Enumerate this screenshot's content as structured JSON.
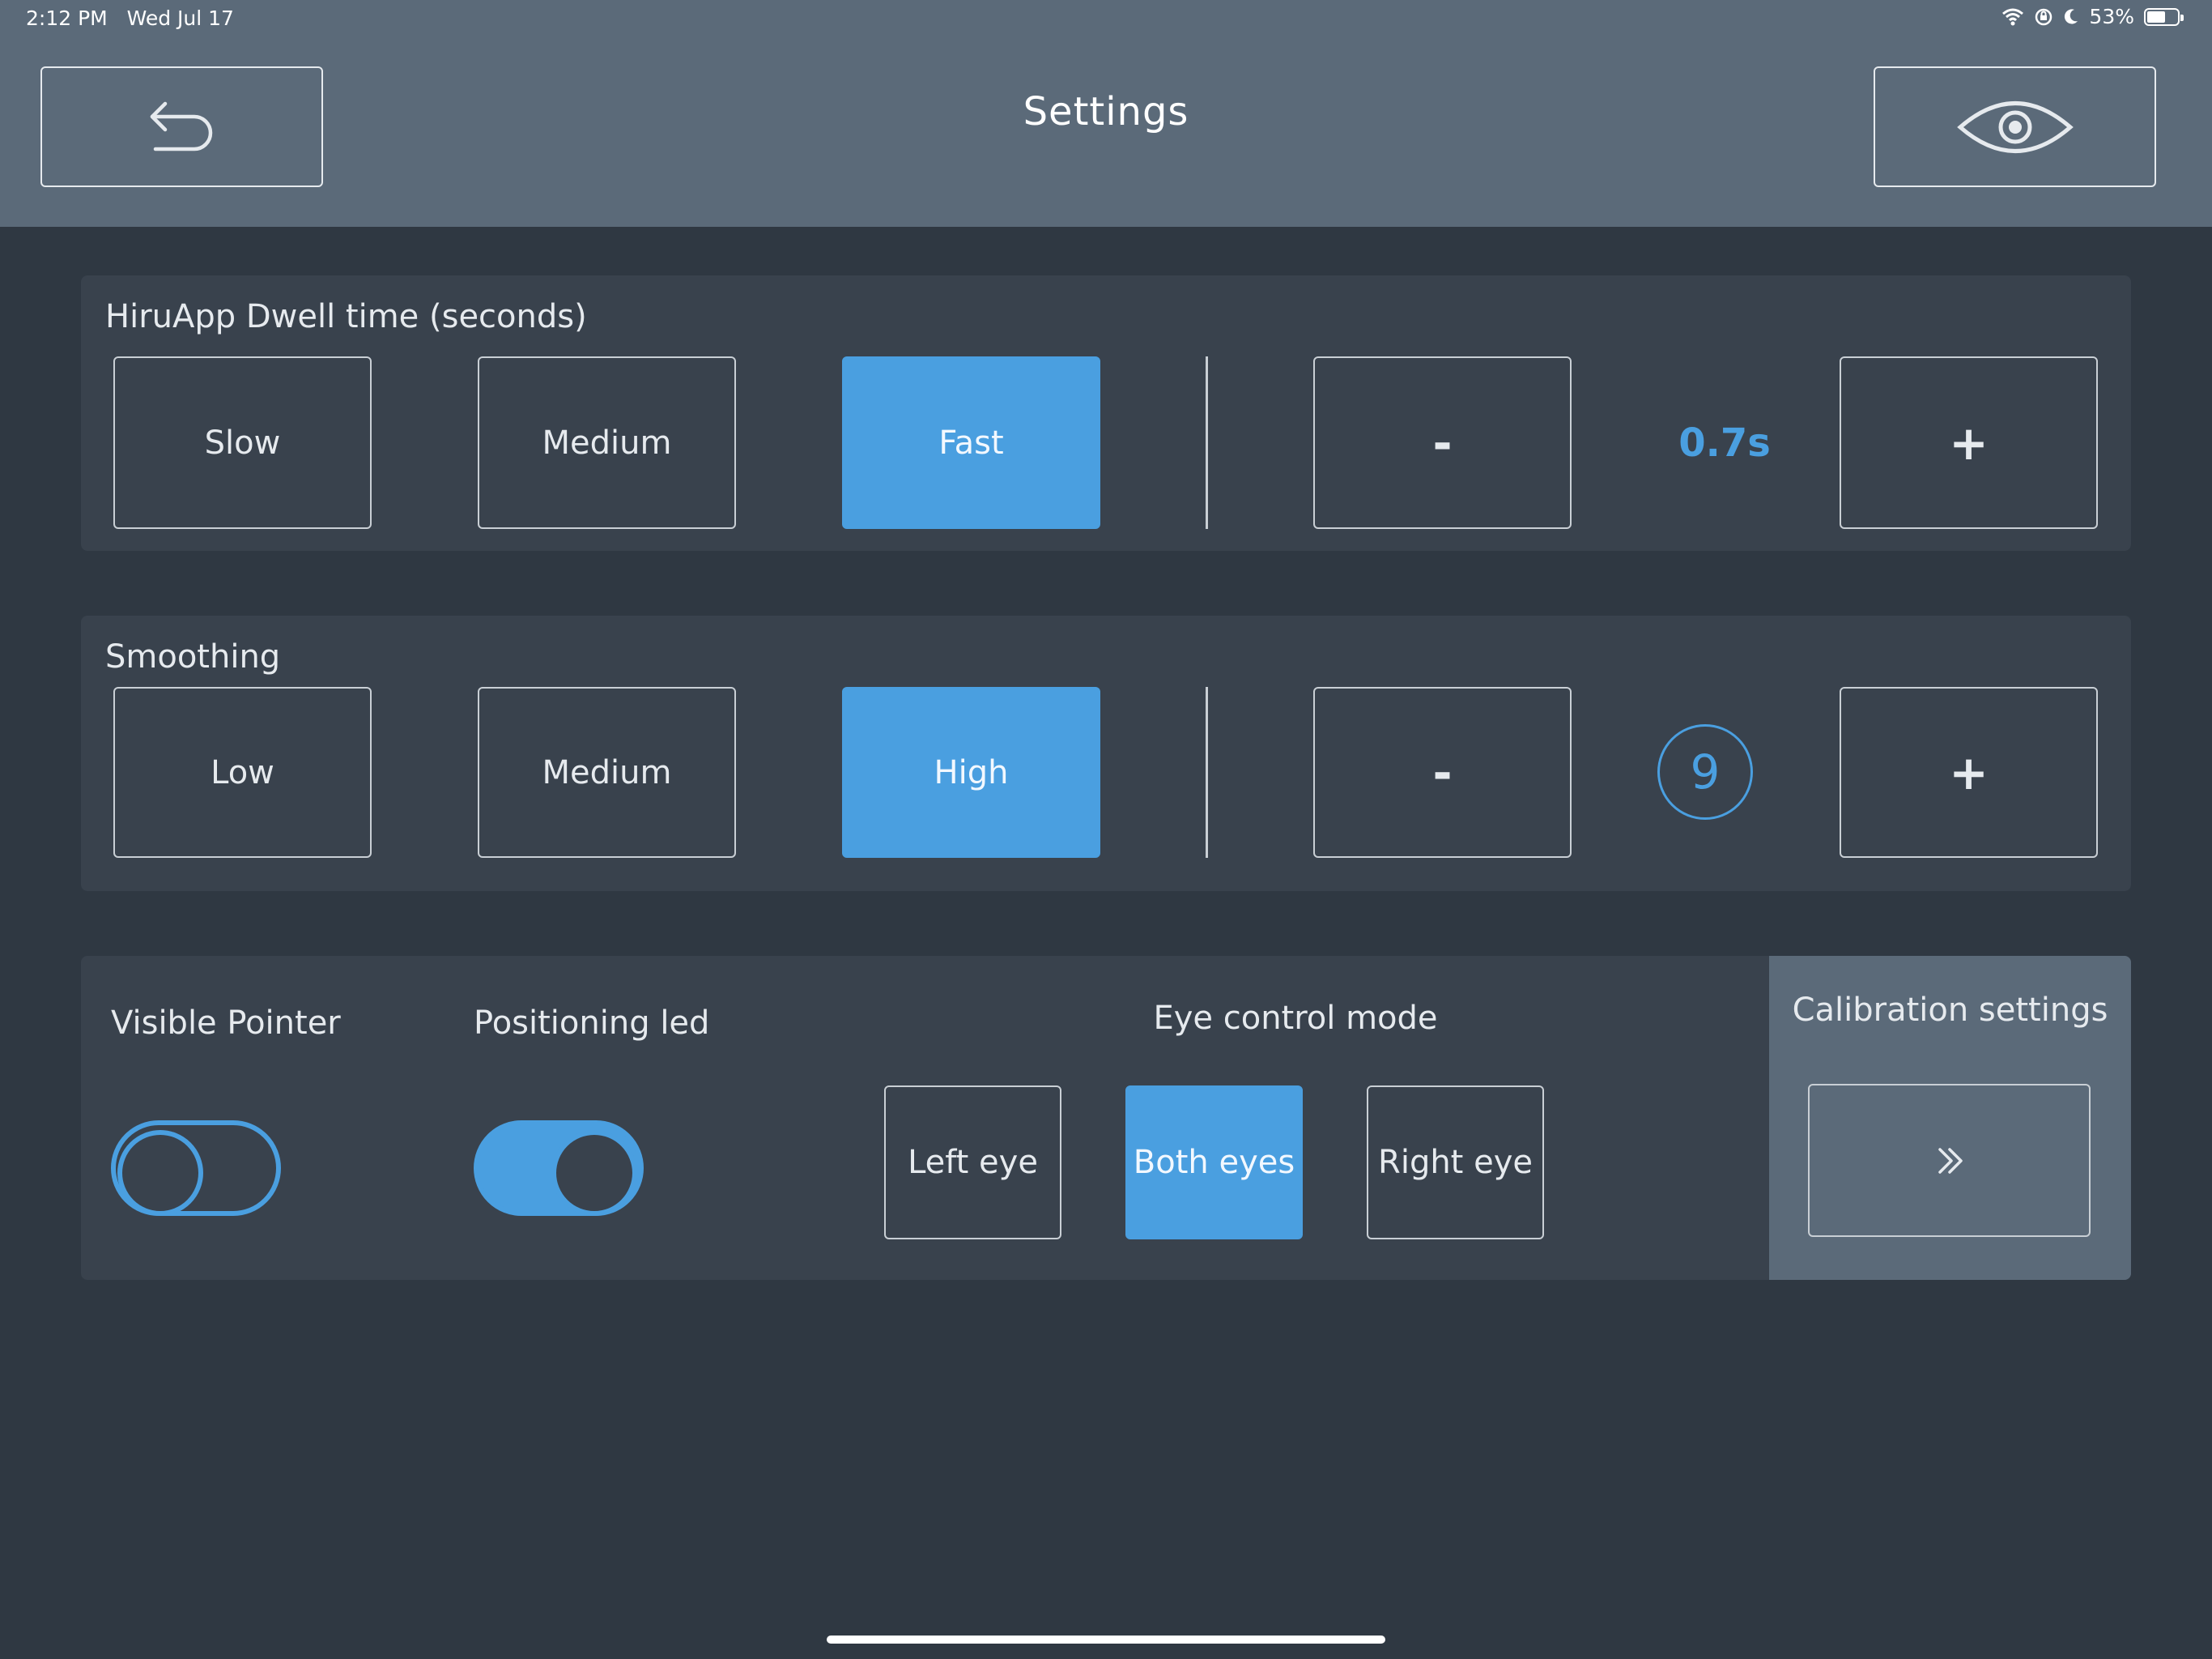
{
  "status_bar": {
    "time": "2:12 PM",
    "date": "Wed Jul 17",
    "battery": "53%"
  },
  "header": {
    "title": "Settings",
    "back_icon": "undo-arrow-icon",
    "eye_icon": "eye-icon"
  },
  "dwell": {
    "label": "HiruApp Dwell time (seconds)",
    "presets": [
      "Slow",
      "Medium",
      "Fast"
    ],
    "selected": "Fast",
    "decrement": "-",
    "increment": "+",
    "value": "0.7s"
  },
  "smoothing": {
    "label": "Smoothing",
    "presets": [
      "Low",
      "Medium",
      "High"
    ],
    "selected": "High",
    "decrement": "-",
    "increment": "+",
    "value": "9"
  },
  "options": {
    "visible_pointer": {
      "label": "Visible Pointer",
      "on": false
    },
    "positioning_led": {
      "label": "Positioning led",
      "on": true
    },
    "eye_control": {
      "label": "Eye control mode",
      "modes": [
        "Left eye",
        "Both eyes",
        "Right eye"
      ],
      "selected": "Both eyes"
    }
  },
  "calibration": {
    "label": "Calibration settings",
    "icon": "double-chevron-right-icon"
  },
  "colors": {
    "accent": "#4a9fe0",
    "header_bg": "#5b6a79",
    "page_bg": "#2f3842",
    "panel_bg": "#39424d"
  }
}
